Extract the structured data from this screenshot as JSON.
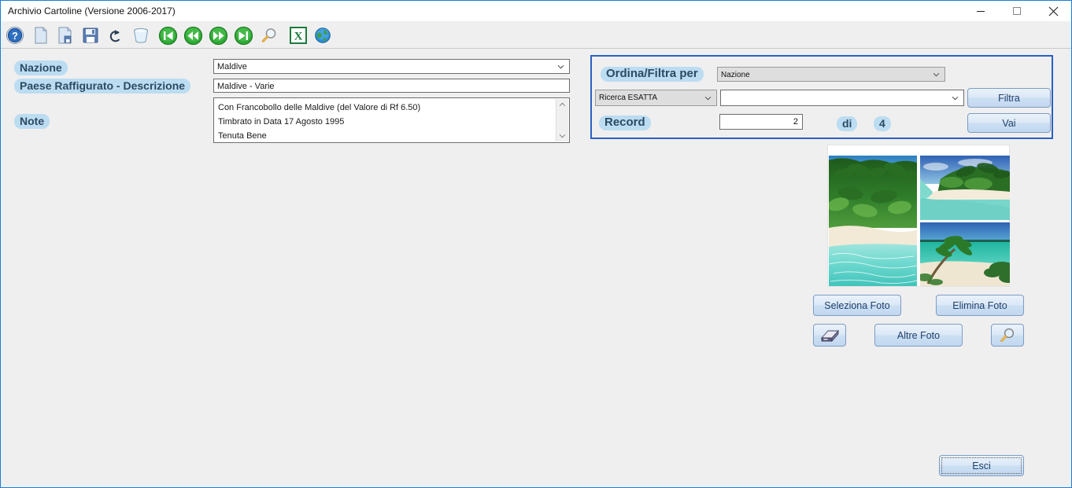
{
  "window": {
    "title": "Archivio Cartoline (Versione 2006-2017)",
    "minimize_label": "minimize",
    "maximize_label": "maximize",
    "close_label": "close",
    "border_color": "#1a7fd4"
  },
  "toolbar": {
    "items": [
      {
        "name": "help-icon",
        "tooltip": "Aiuto"
      },
      {
        "name": "new-document-icon",
        "tooltip": "Nuovo"
      },
      {
        "name": "save-as-icon",
        "tooltip": "Salva con nome"
      },
      {
        "name": "save-icon",
        "tooltip": "Salva"
      },
      {
        "name": "undo-icon",
        "tooltip": "Annulla"
      },
      {
        "name": "delete-trash-icon",
        "tooltip": "Elimina"
      },
      {
        "name": "first-record-icon",
        "tooltip": "Primo"
      },
      {
        "name": "previous-record-icon",
        "tooltip": "Precedente"
      },
      {
        "name": "next-record-icon",
        "tooltip": "Successivo"
      },
      {
        "name": "last-record-icon",
        "tooltip": "Ultimo"
      },
      {
        "name": "search-magnifier-icon",
        "tooltip": "Cerca"
      },
      {
        "name": "excel-export-icon",
        "tooltip": "Esporta Excel"
      },
      {
        "name": "globe-web-icon",
        "tooltip": "Web"
      }
    ]
  },
  "form": {
    "nazione_label": "Nazione",
    "nazione_value": "Maldive",
    "paese_label": "Paese Raffigurato - Descrizione",
    "paese_value": "Maldive - Varie",
    "note_label": "Note",
    "note_lines": [
      "Con Francobollo delle Maldive (del Valore di Rf 6.50)",
      "Timbrato in Data 17 Agosto 1995",
      "Tenuta Bene"
    ]
  },
  "filter": {
    "title": "Ordina/Filtra per",
    "order_field_value": "Nazione",
    "search_mode_value": "Ricerca ESATTA",
    "search_value": "",
    "filter_button": "Filtra",
    "record_label": "Record",
    "record_current": "2",
    "record_of": "di",
    "record_total": "4",
    "go_button": "Vai"
  },
  "photos": {
    "select_button": "Seleziona Foto",
    "delete_button": "Elimina Foto",
    "scan_button_icon": "scanner-icon",
    "more_button": "Altre Foto",
    "zoom_button_icon": "magnifier-icon"
  },
  "footer": {
    "exit_button": "Esci"
  },
  "colors": {
    "label_bg": "#bcdcf2",
    "label_text": "#2b4a63",
    "panel_border": "#2b5fc4",
    "button_text": "#20406b",
    "window_bg": "#efefef"
  }
}
